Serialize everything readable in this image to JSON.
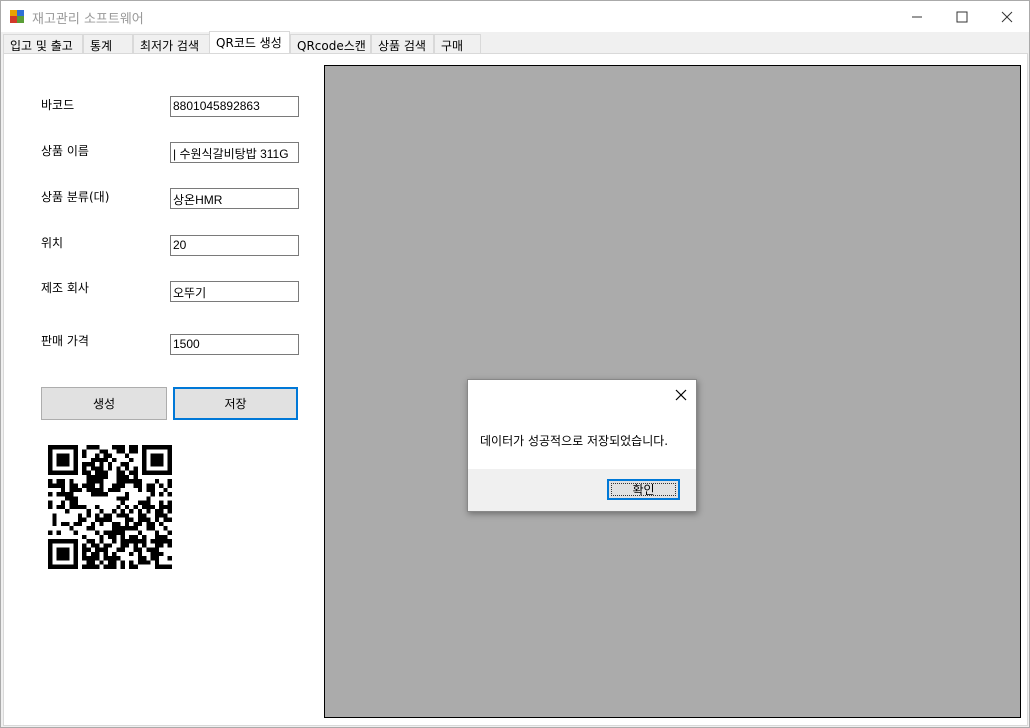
{
  "window": {
    "title": "재고관리 소프트웨어",
    "icons": {
      "app": "app-icon",
      "minimize": "minimize-icon",
      "maximize": "maximize-icon",
      "close": "close-icon"
    }
  },
  "tabs": [
    {
      "label": "입고 및 출고",
      "active": false
    },
    {
      "label": "통계",
      "active": false
    },
    {
      "label": "최저가 검색",
      "active": false
    },
    {
      "label": "QR코드 생성",
      "active": true
    },
    {
      "label": "QRcode스캔",
      "active": false
    },
    {
      "label": "상품 검색",
      "active": false
    },
    {
      "label": "구매",
      "active": false
    }
  ],
  "form": {
    "barcode_label": "바코드",
    "barcode_value": "8801045892863",
    "name_label": "상품 이름",
    "name_value": "| 수원식갈비탕밥 311G",
    "category_label": "상품 분류(대)",
    "category_value": "상온HMR",
    "location_label": "위치",
    "location_value": "20",
    "maker_label": "제조 회사",
    "maker_value": "오뚜기",
    "price_label": "판매 가격",
    "price_value": "1500"
  },
  "buttons": {
    "generate_label": "생성",
    "save_label": "저장"
  },
  "dialog": {
    "message": "데이터가 성공적으로 저장되었습니다.",
    "ok_label": "확인"
  },
  "colors": {
    "canvas_background": "#ababab",
    "focus_border": "#0078d7"
  }
}
